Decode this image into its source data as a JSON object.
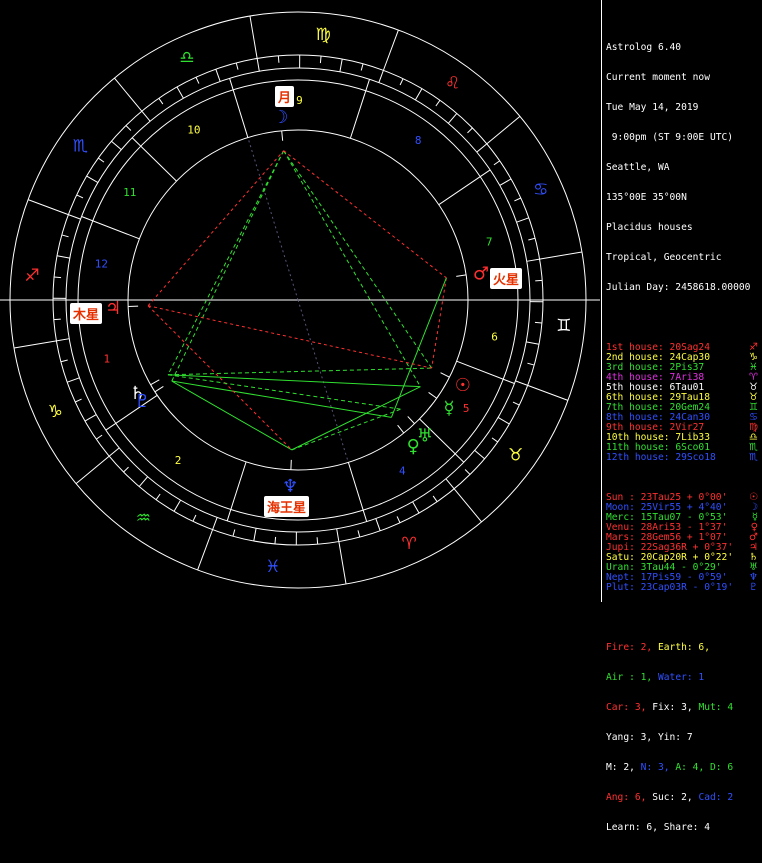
{
  "app": {
    "title": "Astrolog 6.40",
    "header_lines": [
      "Current moment now",
      "Tue May 14, 2019",
      " 9:00pm (ST 9:00E UTC)",
      "Seattle, WA",
      "135°00E 35°00N",
      "Placidus houses",
      "Tropical, Geocentric",
      "Julian Day: 2458618.00000"
    ]
  },
  "houses": [
    {
      "label": "1st house:",
      "value": "20Sag24",
      "glyph": "♐",
      "color": "#ff3030"
    },
    {
      "label": "2nd house:",
      "value": "24Cap30",
      "glyph": "♑",
      "color": "#ffff40"
    },
    {
      "label": "3rd house:",
      "value": "2Pis37",
      "glyph": "♓",
      "color": "#30e030"
    },
    {
      "label": "4th house:",
      "value": "7Ari38",
      "glyph": "♈",
      "color": "#e030e0"
    },
    {
      "label": "5th house:",
      "value": "6Tau01",
      "glyph": "♉",
      "color": "#ffffff"
    },
    {
      "label": "6th house:",
      "value": "29Tau18",
      "glyph": "♉",
      "color": "#ffff40"
    },
    {
      "label": "7th house:",
      "value": "20Gem24",
      "glyph": "♊",
      "color": "#30e030"
    },
    {
      "label": "8th house:",
      "value": "24Can30",
      "glyph": "♋",
      "color": "#3050ff"
    },
    {
      "label": "9th house:",
      "value": "2Vir27",
      "glyph": "♍",
      "color": "#ff3030"
    },
    {
      "label": "10th house:",
      "value": "7Lib33",
      "glyph": "♎",
      "color": "#ffff40"
    },
    {
      "label": "11th house:",
      "value": "6Sco01",
      "glyph": "♏",
      "color": "#30e030"
    },
    {
      "label": "12th house:",
      "value": "29Sco18",
      "glyph": "♏",
      "color": "#3050ff"
    }
  ],
  "planets": [
    {
      "label": "Sun :",
      "value": "23Tau25",
      "speed": "+ 0°00'",
      "glyph": "☉",
      "color": "#ff3030"
    },
    {
      "label": "Moon:",
      "value": "25Vir55",
      "speed": "+ 4°40'",
      "glyph": "☽",
      "color": "#3050ff"
    },
    {
      "label": "Merc:",
      "value": "15Tau07",
      "speed": "- 0°53'",
      "glyph": "☿",
      "color": "#30e030"
    },
    {
      "label": "Venu:",
      "value": "28Ari53",
      "speed": "- 1°37'",
      "glyph": "♀",
      "color": "#ff3030"
    },
    {
      "label": "Mars:",
      "value": "28Gem56",
      "speed": "+ 1°07'",
      "glyph": "♂",
      "color": "#ff3030"
    },
    {
      "label": "Jupi:",
      "value": "22Sag36R",
      "speed": "+ 0°37'",
      "glyph": "♃",
      "color": "#ff3030"
    },
    {
      "label": "Satu:",
      "value": "20Cap20R",
      "speed": "+ 0°22'",
      "glyph": "♄",
      "color": "#ffff40"
    },
    {
      "label": "Uran:",
      "value": "3Tau44",
      "speed": "- 0°29'",
      "glyph": "♅",
      "color": "#30e030"
    },
    {
      "label": "Nept:",
      "value": "17Pis59",
      "speed": "- 0°59'",
      "glyph": "♆",
      "color": "#3050ff"
    },
    {
      "label": "Plut:",
      "value": "23Cap03R",
      "speed": "- 0°19'",
      "glyph": "♇",
      "color": "#3050ff"
    }
  ],
  "elements": {
    "fire": "Fire: 2,",
    "earth": "Earth: 6,",
    "air": "Air : 1,",
    "water": "Water: 1",
    "car": "Car: 3,",
    "fix": "Fix: 3,",
    "mut": "Mut: 4",
    "yang": "Yang: 3, Yin: 7",
    "m": "M: 2,",
    "n": "N: 3,",
    "a": "A: 4,",
    "d": "D: 6",
    "ang": "Ang: 6,",
    "suc": "Suc: 2,",
    "cad": "Cad: 2",
    "learn": "Learn: 6, Share: 4"
  },
  "colors": {
    "fire": "#ff3030",
    "earth": "#ffff40",
    "air": "#30e030",
    "water": "#3050ff",
    "white": "#ffffff",
    "purple": "#e030e0"
  },
  "captions": {
    "moon": "月",
    "mars": "火星",
    "jupiter": "木星",
    "neptune": "海王星"
  },
  "wheel": {
    "ascendant_deg": 260.4,
    "cusps": [
      260.4,
      294.5,
      332.62,
      7.63,
      36.02,
      59.3,
      80.4,
      114.5,
      152.45,
      187.55,
      216.02,
      239.3
    ],
    "house_numbers": [
      "1",
      "2",
      "3",
      "4",
      "5",
      "6",
      "7",
      "8",
      "9",
      "10",
      "11",
      "12"
    ],
    "house_number_colors": [
      "#ff3030",
      "#ffff40",
      "#30e030",
      "#3050ff",
      "#ff3030",
      "#ffff40",
      "#30e030",
      "#3050ff",
      "#ffff40",
      "#ffff40",
      "#30e030",
      "#3050ff"
    ],
    "signs": [
      {
        "glyph": "♈",
        "color": "#ff3030"
      },
      {
        "glyph": "♉",
        "color": "#ffff40"
      },
      {
        "glyph": "♊",
        "color": "#ffffff"
      },
      {
        "glyph": "♋",
        "color": "#3050ff"
      },
      {
        "glyph": "♌",
        "color": "#ff3030"
      },
      {
        "glyph": "♍",
        "color": "#ffff40"
      },
      {
        "glyph": "♎",
        "color": "#30e030"
      },
      {
        "glyph": "♏",
        "color": "#3050ff"
      },
      {
        "glyph": "♐",
        "color": "#ff3030"
      },
      {
        "glyph": "♑",
        "color": "#ffff40"
      },
      {
        "glyph": "♒",
        "color": "#30e030"
      },
      {
        "glyph": "♓",
        "color": "#3050ff"
      }
    ],
    "planet_positions": [
      {
        "key": "sun",
        "glyph": "☉",
        "lon": 53.4,
        "color": "#ff3030"
      },
      {
        "key": "moon",
        "glyph": "☽",
        "lon": 175.9,
        "color": "#3050ff"
      },
      {
        "key": "mercury",
        "glyph": "☿",
        "lon": 45.1,
        "color": "#30e030"
      },
      {
        "key": "venus",
        "glyph": "♀",
        "lon": 28.9,
        "color": "#30e030"
      },
      {
        "key": "mars",
        "glyph": "♂",
        "lon": 88.9,
        "color": "#ff3030"
      },
      {
        "key": "jupiter",
        "glyph": "♃",
        "lon": 262.6,
        "color": "#ff3030"
      },
      {
        "key": "saturn",
        "glyph": "♄",
        "lon": 290.3,
        "color": "#ffffff"
      },
      {
        "key": "uranus",
        "glyph": "♅",
        "lon": 33.7,
        "color": "#30e030"
      },
      {
        "key": "neptune",
        "glyph": "♆",
        "lon": 348.0,
        "color": "#3050ff"
      },
      {
        "key": "pluto",
        "glyph": "♇",
        "lon": 293.1,
        "color": "#3050ff"
      }
    ]
  }
}
